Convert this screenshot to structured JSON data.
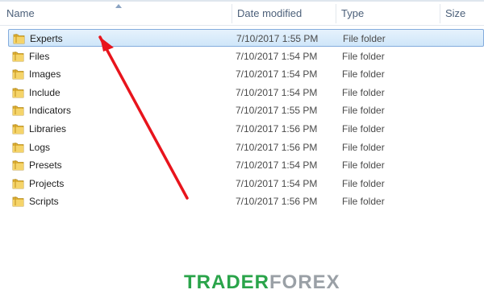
{
  "columns": {
    "name": "Name",
    "date_modified": "Date modified",
    "type": "Type",
    "size": "Size"
  },
  "files": [
    {
      "name": "Experts",
      "date": "7/10/2017 1:55 PM",
      "type": "File folder",
      "selected": true
    },
    {
      "name": "Files",
      "date": "7/10/2017 1:54 PM",
      "type": "File folder"
    },
    {
      "name": "Images",
      "date": "7/10/2017 1:54 PM",
      "type": "File folder"
    },
    {
      "name": "Include",
      "date": "7/10/2017 1:54 PM",
      "type": "File folder"
    },
    {
      "name": "Indicators",
      "date": "7/10/2017 1:55 PM",
      "type": "File folder"
    },
    {
      "name": "Libraries",
      "date": "7/10/2017 1:56 PM",
      "type": "File folder"
    },
    {
      "name": "Logs",
      "date": "7/10/2017 1:56 PM",
      "type": "File folder"
    },
    {
      "name": "Presets",
      "date": "7/10/2017 1:54 PM",
      "type": "File folder"
    },
    {
      "name": "Projects",
      "date": "7/10/2017 1:54 PM",
      "type": "File folder"
    },
    {
      "name": "Scripts",
      "date": "7/10/2017 1:56 PM",
      "type": "File folder"
    }
  ],
  "watermark": {
    "part1": "TRADER",
    "part2": "FOREX"
  },
  "colors": {
    "selection": "#cfe6f9",
    "selection_border": "#84acdd",
    "folder": "#f2c94c",
    "arrow": "#e8141c",
    "watermark_green": "#2aa44a"
  },
  "icons": {
    "folder": "folder-icon",
    "sort": "sort-ascending-icon"
  }
}
